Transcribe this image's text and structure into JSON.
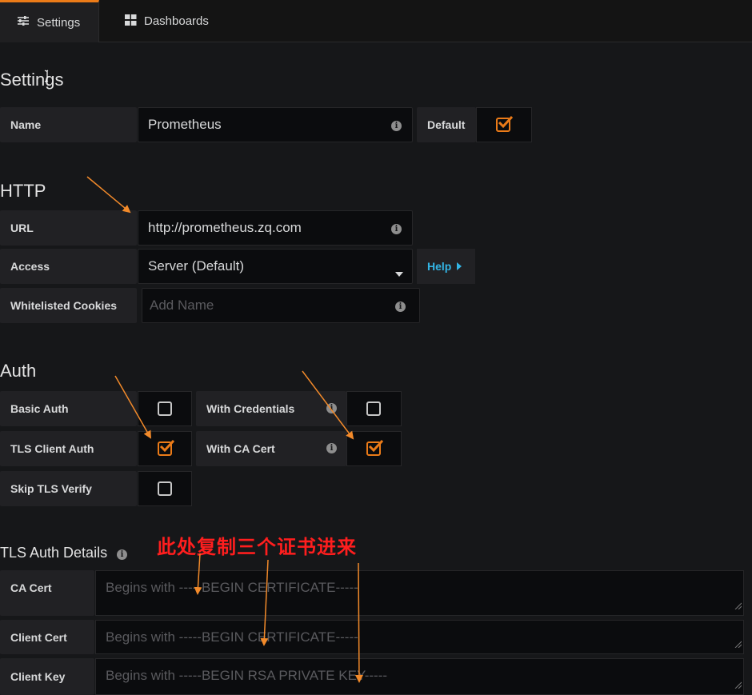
{
  "tabs": [
    {
      "label": "Settings",
      "icon": "sliders-icon",
      "active": true
    },
    {
      "label": "Dashboards",
      "icon": "grid-icon",
      "active": false
    }
  ],
  "settings": {
    "title": "Settings",
    "name_label": "Name",
    "name_value": "Prometheus",
    "default_label": "Default",
    "default_checked": true
  },
  "http": {
    "title": "HTTP",
    "url_label": "URL",
    "url_value": "http://prometheus.zq.com",
    "access_label": "Access",
    "access_value": "Server (Default)",
    "help_label": "Help",
    "cookies_label": "Whitelisted Cookies",
    "cookies_placeholder": "Add Name"
  },
  "auth": {
    "title": "Auth",
    "basic_auth_label": "Basic Auth",
    "basic_auth_checked": false,
    "with_credentials_label": "With Credentials",
    "with_credentials_checked": false,
    "tls_client_auth_label": "TLS Client Auth",
    "tls_client_auth_checked": true,
    "with_ca_cert_label": "With CA Cert",
    "with_ca_cert_checked": true,
    "skip_tls_label": "Skip TLS Verify",
    "skip_tls_checked": false
  },
  "tls": {
    "title": "TLS Auth Details",
    "annotation": "此处复制三个证书进来",
    "ca_cert_label": "CA Cert",
    "ca_cert_placeholder": "Begins with -----BEGIN CERTIFICATE-----",
    "client_cert_label": "Client Cert",
    "client_cert_placeholder": "Begins with -----BEGIN CERTIFICATE-----",
    "client_key_label": "Client Key",
    "client_key_placeholder": "Begins with -----BEGIN RSA PRIVATE KEY-----"
  },
  "colors": {
    "accent": "#eb7b18",
    "link": "#33b5e5",
    "annotation": "#ff1e1e",
    "background": "#161719"
  }
}
